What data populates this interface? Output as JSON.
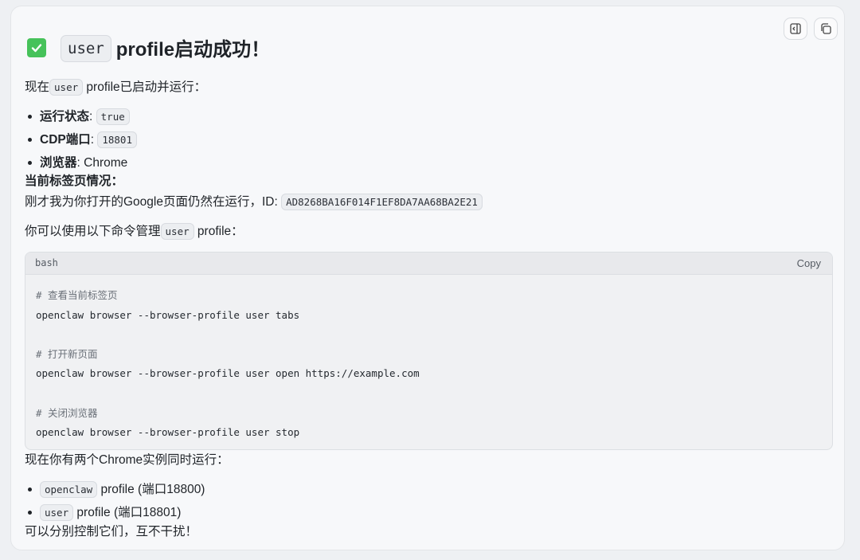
{
  "toolbar": {
    "sidebar_icon": "sidebar-toggle-icon",
    "copy_icon": "copy-icon"
  },
  "header": {
    "emoji": "white-check-mark",
    "code": "user",
    "text": "profile启动成功！"
  },
  "intro": {
    "pre": "现在",
    "code": "user",
    "post": " profile已启动并运行："
  },
  "status_items": [
    {
      "label": "运行状态",
      "sep": ": ",
      "code": "true"
    },
    {
      "label": "CDP端口",
      "sep": ": ",
      "code": "18801"
    },
    {
      "label": "浏览器",
      "sep": ": ",
      "value": "Chrome"
    }
  ],
  "tabs_heading": "当前标签页情况：",
  "tabs_line": {
    "text": "刚才我为你打开的Google页面仍然在运行，ID: ",
    "code": "AD8268BA16F014F1EF8DA7AA68BA2E21"
  },
  "manage_line": {
    "pre": "你可以使用以下命令管理",
    "code": "user",
    "post": " profile："
  },
  "code_block": {
    "language": "bash",
    "copy_label": "Copy",
    "lines": [
      "# 查看当前标签页",
      "openclaw browser --browser-profile user tabs",
      "",
      "# 打开新页面",
      "openclaw browser --browser-profile user open https://example.com",
      "",
      "# 关闭浏览器",
      "openclaw browser --browser-profile user stop"
    ]
  },
  "instances_line": "现在你有两个Chrome实例同时运行：",
  "instances": [
    {
      "code": "openclaw",
      "text": " profile (端口18800)"
    },
    {
      "code": "user",
      "text": " profile (端口18801)"
    }
  ],
  "closing": "可以分别控制它们，互不干扰！"
}
